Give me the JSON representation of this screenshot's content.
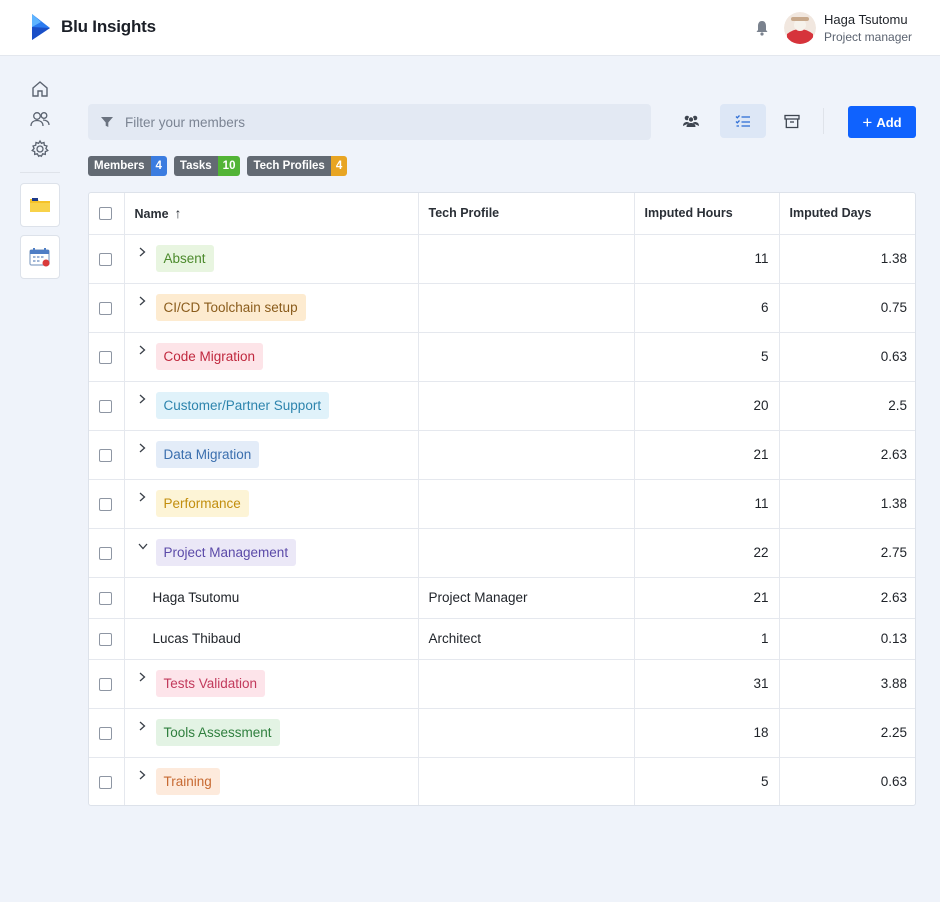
{
  "app": {
    "name": "Blu Insights"
  },
  "user": {
    "name": "Haga Tsutomu",
    "role": "Project manager"
  },
  "search": {
    "placeholder": "Filter your members"
  },
  "toolbar": {
    "add_label": "Add"
  },
  "badges": [
    {
      "label": "Members",
      "count": "4",
      "color": "#3b7ce0"
    },
    {
      "label": "Tasks",
      "count": "10",
      "color": "#52b436"
    },
    {
      "label": "Tech Profiles",
      "count": "4",
      "color": "#e8a523"
    }
  ],
  "table": {
    "columns": {
      "name": "Name",
      "tech_profile": "Tech Profile",
      "imputed_hours": "Imputed Hours",
      "imputed_days": "Imputed Days"
    },
    "rows": [
      {
        "type": "group",
        "name": "Absent",
        "hours": "11",
        "days": "1.38",
        "bg": "#e8f5e0",
        "fg": "#4c8a2c",
        "expanded": false
      },
      {
        "type": "group",
        "name": "CI/CD Toolchain setup",
        "hours": "6",
        "days": "0.75",
        "bg": "#fdebd0",
        "fg": "#8a5c1c",
        "expanded": false
      },
      {
        "type": "group",
        "name": "Code Migration",
        "hours": "5",
        "days": "0.63",
        "bg": "#fde4e8",
        "fg": "#c0283e",
        "expanded": false
      },
      {
        "type": "group",
        "name": "Customer/Partner Support",
        "hours": "20",
        "days": "2.5",
        "bg": "#e0f2fa",
        "fg": "#2d84ad",
        "expanded": false
      },
      {
        "type": "group",
        "name": "Data Migration",
        "hours": "21",
        "days": "2.63",
        "bg": "#e3ecf8",
        "fg": "#3b6fae",
        "expanded": false
      },
      {
        "type": "group",
        "name": "Performance",
        "hours": "11",
        "days": "1.38",
        "bg": "#fdf4d6",
        "fg": "#c28e0e",
        "expanded": false
      },
      {
        "type": "group",
        "name": "Project Management",
        "hours": "22",
        "days": "2.75",
        "bg": "#ebe8f7",
        "fg": "#5b4aa8",
        "expanded": true
      },
      {
        "type": "child",
        "name": "Haga Tsutomu",
        "profile": "Project Manager",
        "hours": "21",
        "days": "2.63"
      },
      {
        "type": "child",
        "name": "Lucas Thibaud",
        "profile": "Architect",
        "hours": "1",
        "days": "0.13"
      },
      {
        "type": "group",
        "name": "Tests Validation",
        "hours": "31",
        "days": "3.88",
        "bg": "#fde4ea",
        "fg": "#c23a5c",
        "expanded": false
      },
      {
        "type": "group",
        "name": "Tools Assessment",
        "hours": "18",
        "days": "2.25",
        "bg": "#e3f3e4",
        "fg": "#2f7f3e",
        "expanded": false
      },
      {
        "type": "group",
        "name": "Training",
        "hours": "5",
        "days": "0.63",
        "bg": "#fdeadc",
        "fg": "#c76a32",
        "expanded": false
      }
    ]
  }
}
